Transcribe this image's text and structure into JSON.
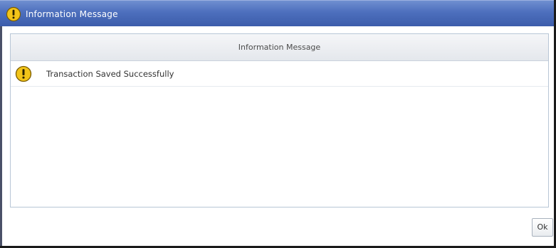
{
  "window": {
    "title": "Information Message",
    "icon": "warning-icon"
  },
  "panel": {
    "header": "Information Message",
    "messages": [
      {
        "icon": "warning-icon",
        "text": "Transaction Saved Successfully"
      }
    ]
  },
  "actions": {
    "ok_label": "Ok"
  },
  "colors": {
    "titlebar": "#4d6fbd",
    "warning_icon_fill": "#f2c419",
    "panel_border": "#b8c6d6"
  }
}
